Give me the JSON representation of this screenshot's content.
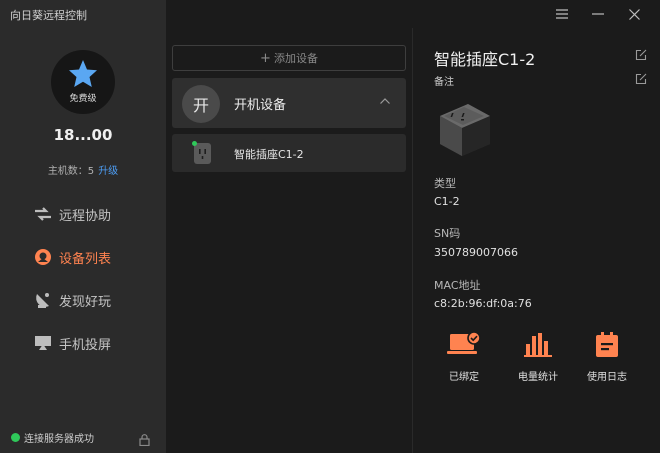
{
  "app": {
    "title": "向日葵远程控制"
  },
  "account": {
    "plan": "免费级",
    "username": "18...00",
    "host_count_label": "主机数：5",
    "upgrade_label": "升级"
  },
  "nav": [
    {
      "label": "远程协助",
      "icon": "remote-assist-icon",
      "active": false
    },
    {
      "label": "设备列表",
      "icon": "device-list-icon",
      "active": true
    },
    {
      "label": "发现好玩",
      "icon": "satellite-dish-icon",
      "active": false
    },
    {
      "label": "手机投屏",
      "icon": "screen-cast-icon",
      "active": false
    }
  ],
  "status": {
    "text": "连接服务器成功",
    "color": "#2fc85a"
  },
  "device_list": {
    "add_label": "添加设备",
    "group": {
      "badge": "开",
      "name": "开机设备",
      "expanded": true
    },
    "devices": [
      {
        "name": "智能插座C1-2",
        "online": true
      }
    ]
  },
  "detail": {
    "title": "智能插座C1-2",
    "remark_label": "备注",
    "type_label": "类型",
    "type_value": "C1-2",
    "sn_label": "SN码",
    "sn_value": "350789007066",
    "mac_label": "MAC地址",
    "mac_value": "c8:2b:96:df:0a:76",
    "actions": [
      {
        "label": "已绑定",
        "icon": "laptop-check-icon"
      },
      {
        "label": "电量统计",
        "icon": "bar-chart-icon"
      },
      {
        "label": "使用日志",
        "icon": "log-book-icon"
      }
    ]
  },
  "colors": {
    "accent": "#ff8350",
    "link": "#4d9df3",
    "sidebar_bg": "#2b2b2b",
    "main_bg": "#1b1b1b"
  }
}
